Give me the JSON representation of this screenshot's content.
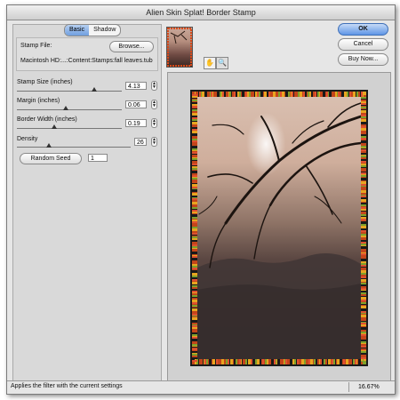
{
  "window": {
    "title": "Alien Skin Splat! Border Stamp"
  },
  "tabs": [
    {
      "label": "Basic",
      "active": true
    },
    {
      "label": "Shadow",
      "active": false
    }
  ],
  "stamp_file": {
    "label": "Stamp File:",
    "browse_label": "Browse...",
    "path": "Macintosh HD:...:Content:Stamps:fall leaves.tub"
  },
  "controls": {
    "stamp_size": {
      "label": "Stamp Size (inches)",
      "value": "4.13",
      "level": 0.74
    },
    "margin": {
      "label": "Margin (inches)",
      "value": "0.06",
      "level": 0.47
    },
    "border_width": {
      "label": "Border Width (inches)",
      "value": "0.19",
      "level": 0.36
    },
    "density": {
      "label": "Density",
      "value": "26",
      "level": 0.28
    }
  },
  "random_seed": {
    "label": "Random Seed",
    "value": "1"
  },
  "buttons": {
    "ok": "OK",
    "cancel": "Cancel",
    "buy_now": "Buy Now..."
  },
  "status": {
    "text": "Applies the filter with the current settings",
    "zoom": "16.67%"
  },
  "icons": {
    "hand_tool": "hand-icon",
    "zoom_tool": "magnifier-icon"
  }
}
